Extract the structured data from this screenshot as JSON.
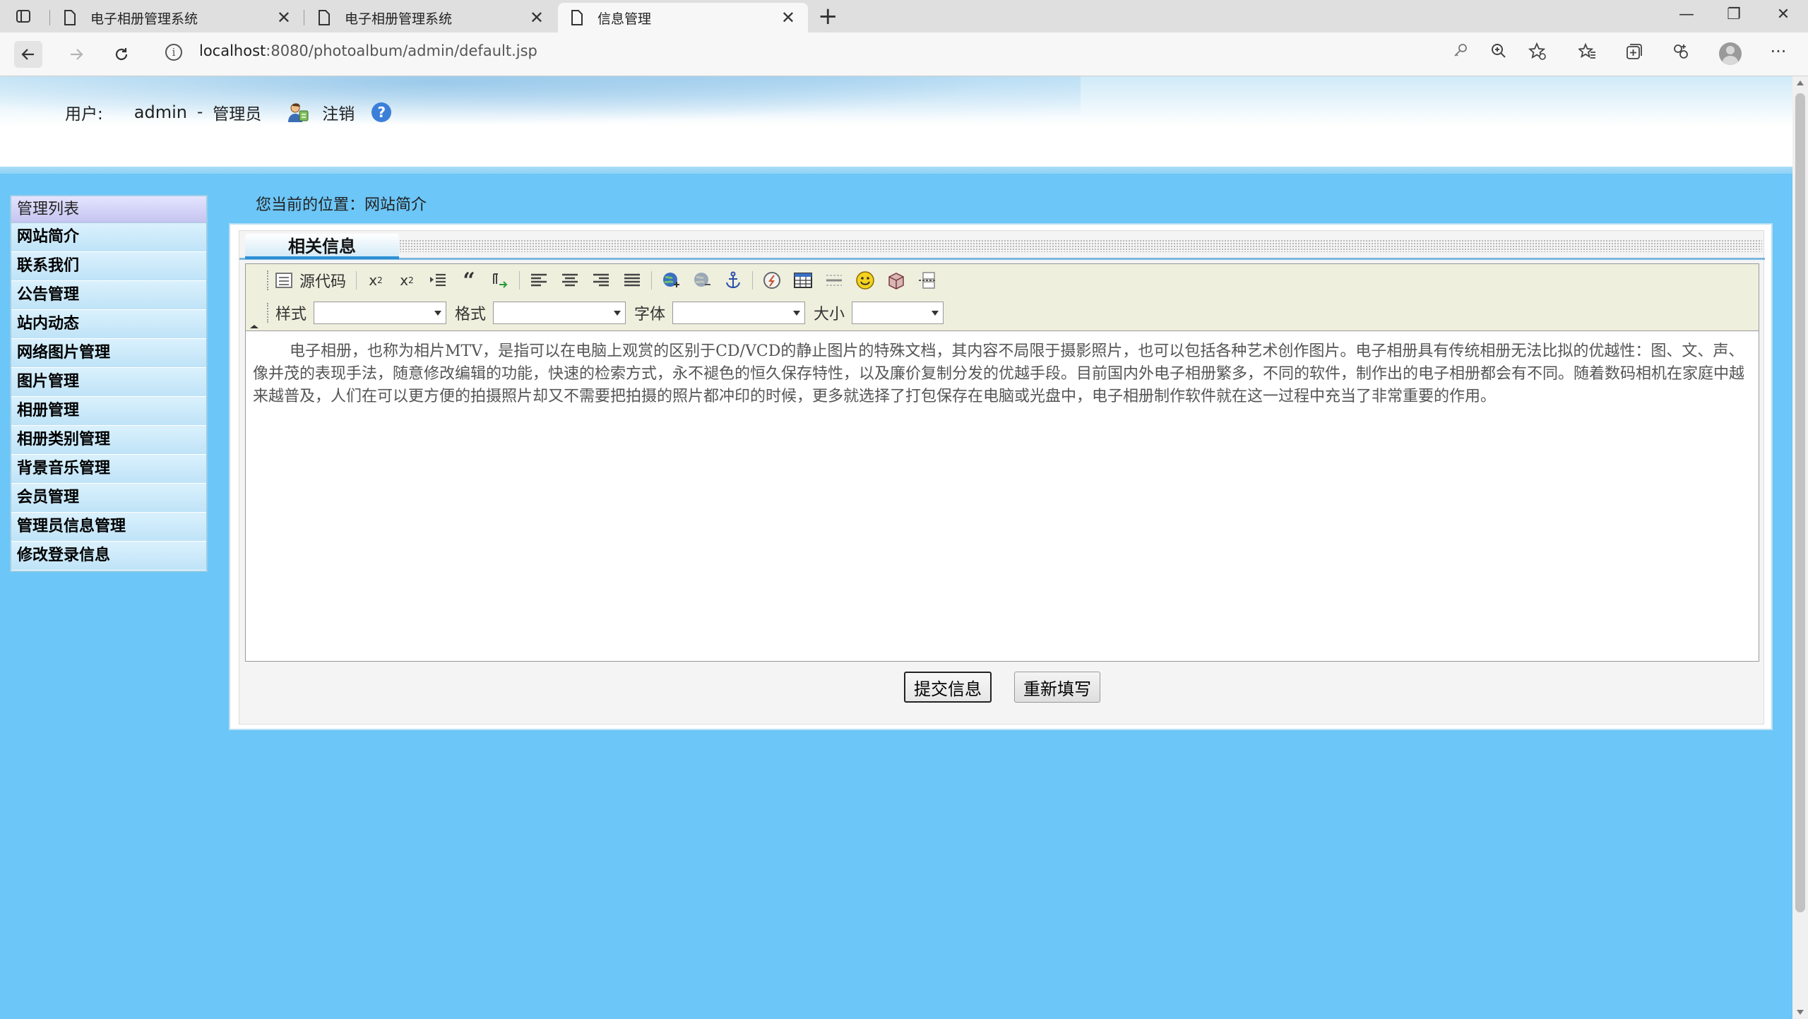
{
  "browser": {
    "tabs": [
      {
        "title": "电子相册管理系统",
        "active": false
      },
      {
        "title": "电子相册管理系统",
        "active": false
      },
      {
        "title": "信息管理",
        "active": true
      }
    ],
    "url_host": "localhost",
    "url_rest": ":8080/photoalbum/admin/default.jsp",
    "icons": [
      "sidebar-toggle-icon",
      "back-arrow-icon",
      "forward-arrow-icon",
      "reload-icon",
      "site-info-icon",
      "key-icon",
      "zoom-in-icon",
      "add-favorite-icon",
      "favorites-icon",
      "collections-icon",
      "extensions-icon",
      "profile-icon",
      "more-icon"
    ]
  },
  "header": {
    "user_label": "用户:",
    "username": "admin",
    "separator": "-",
    "role": "管理员",
    "logout": "注销",
    "help": "?"
  },
  "menu": {
    "title": "管理列表",
    "items": [
      "网站简介",
      "联系我们",
      "公告管理",
      "站内动态",
      "网络图片管理",
      "图片管理",
      "相册管理",
      "相册类别管理",
      "背景音乐管理",
      "会员管理",
      "管理员信息管理",
      "修改登录信息"
    ]
  },
  "breadcrumb": "您当前的位置：网站简介",
  "section_tab": "相关信息",
  "editor": {
    "source_label": "源代码",
    "style_label": "样式",
    "format_label": "格式",
    "font_label": "字体",
    "size_label": "大小",
    "style_value": "",
    "format_value": "",
    "font_value": "",
    "size_value": "",
    "content": "电子相册，也称为相片MTV，是指可以在电脑上观赏的区别于CD/VCD的静止图片的特殊文档，其内容不局限于摄影照片，也可以包括各种艺术创作图片。电子相册具有传统相册无法比拟的优越性：图、文、声、像并茂的表现手法，随意修改编辑的功能，快速的检索方式，永不褪色的恒久保存特性，以及廉价复制分发的优越手段。目前国内外电子相册繁多，不同的软件，制作出的电子相册都会有不同。随着数码相机在家庭中越来越普及，人们在可以更方便的拍摄照片却又不需要把拍摄的照片都冲印的时候，更多就选择了打包保存在电脑或光盘中，电子相册制作软件就在这一过程中充当了非常重要的作用。"
  },
  "actions": {
    "submit": "提交信息",
    "reset": "重新填写"
  },
  "colors": {
    "page_bg": "#6cc6f7",
    "menu_bg": "#c6e6f8",
    "accent": "#2c8fd4"
  }
}
